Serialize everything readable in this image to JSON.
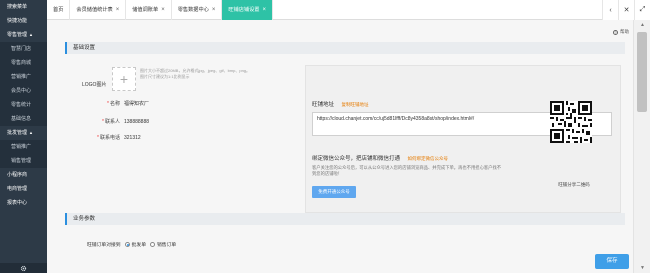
{
  "sidebar": {
    "items": [
      {
        "label": "搜索菜单",
        "type": "group"
      },
      {
        "label": "快捷功能",
        "type": "group"
      },
      {
        "label": "零售管理",
        "type": "group",
        "caret": "▲"
      },
      {
        "label": "智慧门店",
        "type": "sub"
      },
      {
        "label": "零售商城",
        "type": "sub"
      },
      {
        "label": "营销推广",
        "type": "sub"
      },
      {
        "label": "会员中心",
        "type": "sub"
      },
      {
        "label": "零售统计",
        "type": "sub"
      },
      {
        "label": "基础信息",
        "type": "sub"
      },
      {
        "label": "批发管理",
        "type": "group",
        "caret": "▲"
      },
      {
        "label": "营销推广",
        "type": "sub"
      },
      {
        "label": "销售管理",
        "type": "sub"
      },
      {
        "label": "小程序商",
        "type": "group"
      },
      {
        "label": "电商管理",
        "type": "group"
      },
      {
        "label": "报表中心",
        "type": "group"
      }
    ],
    "bottom_icon": "gear-icon"
  },
  "tabs": [
    {
      "label": "首页",
      "closable": false,
      "active": false
    },
    {
      "label": "会员储值统计表",
      "closable": true,
      "active": false
    },
    {
      "label": "储值调账单",
      "closable": true,
      "active": false
    },
    {
      "label": "零售数据中心",
      "closable": true,
      "active": false
    },
    {
      "label": "旺铺店铺设置",
      "closable": true,
      "active": true
    }
  ],
  "tab_actions": [
    "chevron-left-icon",
    "close-icon",
    "expand-icon"
  ],
  "help": {
    "label": "帮助"
  },
  "sections": {
    "basic": "基础设置",
    "business": "业务参数"
  },
  "logo": {
    "label": "LOGO图片",
    "hint": "图片大小不超过20MB，允许格式jpg、jpeg、gif、bmp、png。图片尺寸建议为1:1比例显示"
  },
  "fields": [
    {
      "label": "名称",
      "required": true,
      "value": "福得知农厂"
    },
    {
      "label": "联系人",
      "required": true,
      "value": "138888888"
    },
    {
      "label": "联系电话",
      "required": true,
      "value": "321312"
    }
  ],
  "store_url": {
    "title": "旺铺地址",
    "link": "复制旺铺地址",
    "value": "https://cloud.chanjet.com/cc/uj5d81lfff/Dc8y4358a8st/shop/index.html#/"
  },
  "wechat": {
    "title": "绑定微信公众号，把店铺和微信打通",
    "link": "如何绑定微信公众号",
    "desc": "客户关注您的公众号后，可以从公众号进入您的店铺浏览商品、并完成下单。再也不用担心客户找不到您的店铺啦！",
    "button": "免费开通公众号"
  },
  "qr": {
    "caption": "旺铺分享二维码"
  },
  "order_mode": {
    "label": "旺铺订单对接到",
    "options": [
      {
        "label": "批发单",
        "selected": true
      },
      {
        "label": "销售订单",
        "selected": false
      }
    ]
  },
  "save_button": "保存",
  "colors": {
    "sidebar": "#2d3a47",
    "active_tab": "#2ec2a6",
    "primary": "#3f9fe8",
    "link": "#e57a00"
  }
}
